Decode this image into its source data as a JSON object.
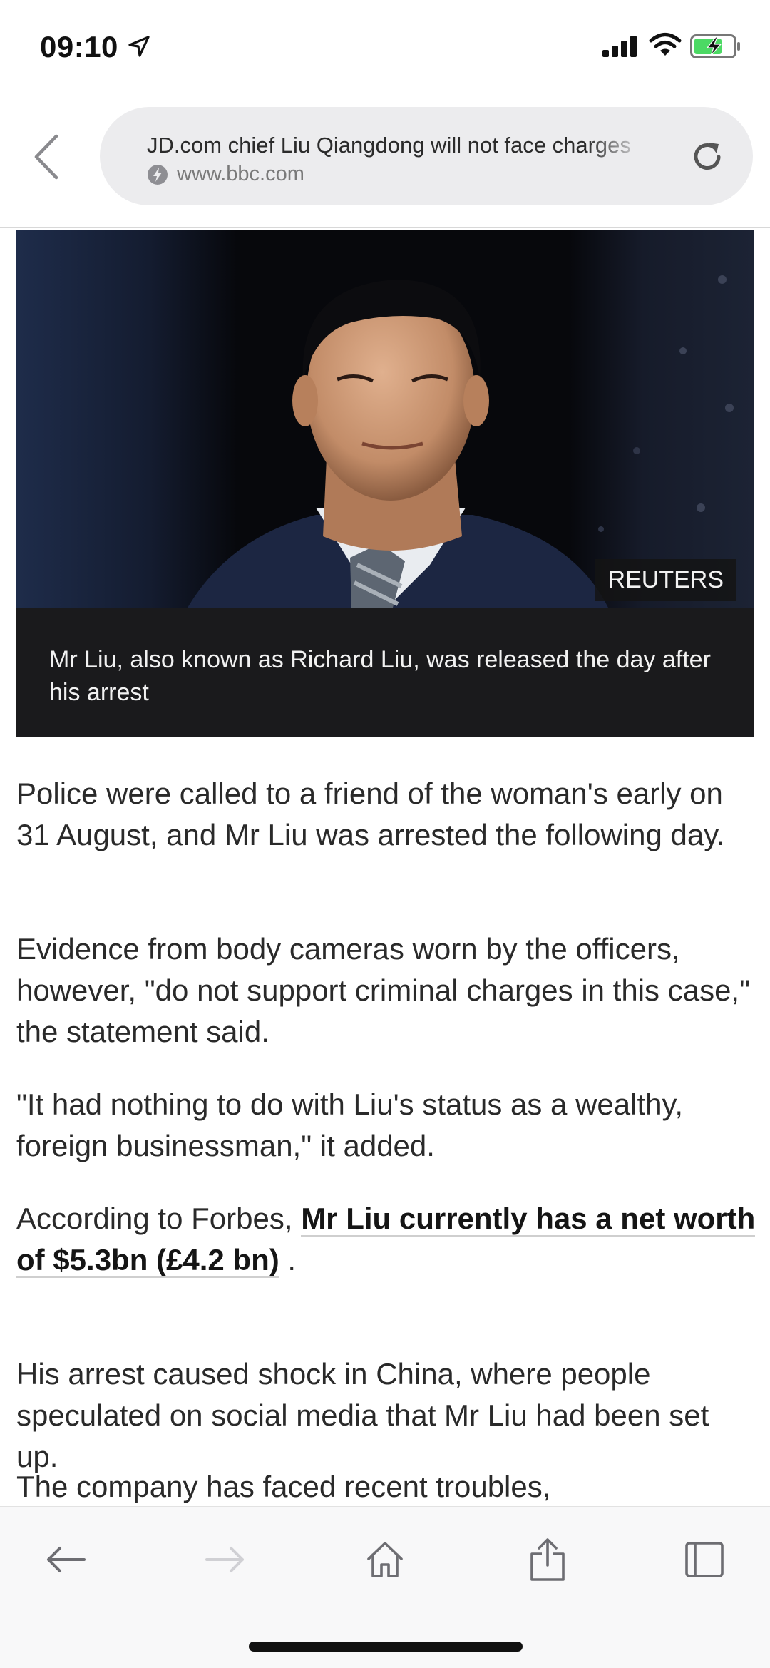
{
  "status_bar": {
    "time": "09:10"
  },
  "browser": {
    "page_title": "JD.com chief Liu Qiangdong will not face charges",
    "domain": "www.bbc.com"
  },
  "article": {
    "image_credit": "REUTERS",
    "image_caption": "Mr Liu, also known as Richard Liu, was released the day after his arrest",
    "paragraphs": [
      "Police were called to a friend of the woman's early on 31 August, and Mr Liu was arrested the following day.",
      "Evidence from body cameras worn by the officers, however, \"do not support criminal charges in this case,\" the statement said.",
      "\"It had nothing to do with Liu's status as a wealthy, foreign businessman,\" it added."
    ],
    "p4_prefix": "According to Forbes, ",
    "p4_link": "Mr Liu currently has a net worth of $5.3bn (£4.2 bn)",
    "p4_suffix": " .",
    "p5": "His arrest caused shock in China, where people speculated on social media that Mr Liu had been set up.",
    "p6": "The company has faced recent troubles,"
  },
  "icons": {
    "status": [
      "location-arrow-icon",
      "signal-bars-icon",
      "wifi-icon",
      "battery-charging-icon"
    ],
    "toolbar": [
      "back-arrow-icon",
      "forward-arrow-icon",
      "home-icon",
      "share-icon",
      "tabs-icon"
    ]
  },
  "colors": {
    "url_pill": "#ececee",
    "battery_fill": "#4cd964",
    "caption_bg": "#1a1a1c"
  }
}
